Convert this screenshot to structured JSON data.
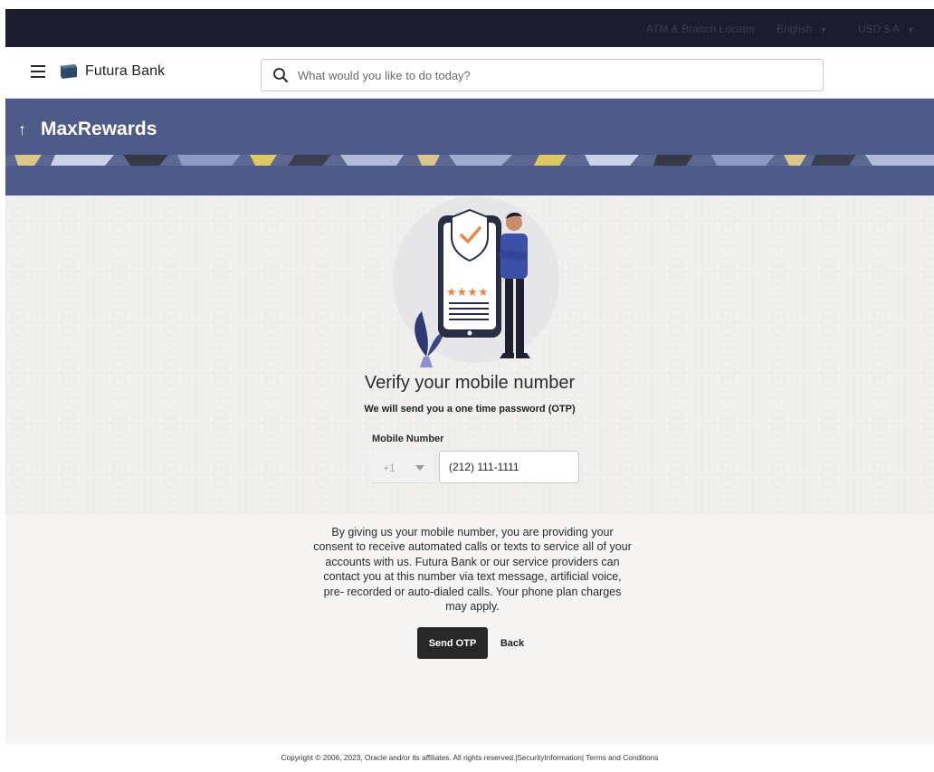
{
  "topbar": {
    "atm_locator": "ATM & Branch Locator",
    "language": "English",
    "currency": "USD $ A"
  },
  "header": {
    "brand_name": "Futura Bank",
    "search_placeholder": "What would you like to do today?",
    "icons": {
      "menu": "hamburger-menu-icon",
      "logo": "futura-bank-logo-icon",
      "search": "search-icon"
    }
  },
  "banner": {
    "back_icon": "up-arrow-icon",
    "title": "MaxRewards"
  },
  "verify": {
    "title": "Verify your mobile number",
    "subtitle": "We will send you a one time password (OTP)",
    "mobile_label": "Mobile Number",
    "country_code": "+1",
    "phone_value": "(212) 111-1111"
  },
  "consent_text": "By giving us your mobile number, you are providing your consent to receive automated calls or texts to service all of your accounts with us. Futura Bank or our service providers can contact you at this number via text message, artificial voice, pre- recorded or auto-dialed calls. Your phone plan charges may apply.",
  "actions": {
    "send_otp": "Send OTP",
    "back": "Back"
  },
  "footer": {
    "copyright": "Copyright © 2006, 2023, Oracle and/or its affiliates. All rights reserved.",
    "security": "SecurityInformation",
    "terms": "Terms and Conditions"
  },
  "colors": {
    "topbar": "#1b1d2e",
    "banner": "#4e5a87",
    "primary_button": "#272727",
    "accent_orange": "#e8874a"
  }
}
